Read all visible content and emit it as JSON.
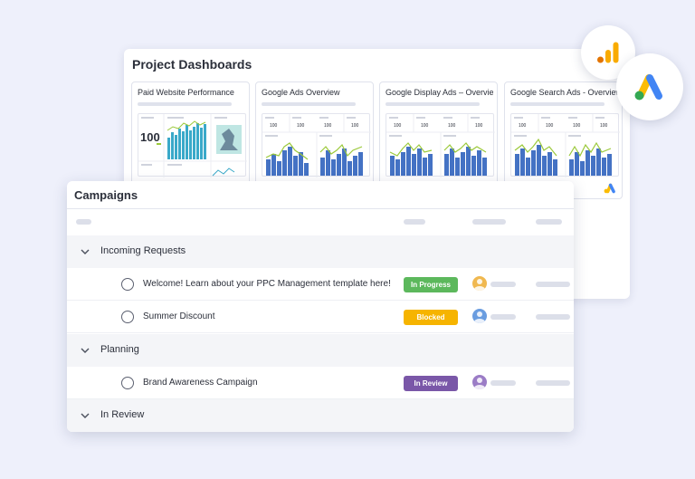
{
  "dashboards": {
    "title": "Project Dashboards",
    "cards": [
      {
        "title": "Paid Website Performance",
        "kpi": "100"
      },
      {
        "title": "Google Ads Overview",
        "kpi": "100"
      },
      {
        "title": "Google Display Ads – Overview",
        "kpi": "100"
      },
      {
        "title": "Google Search Ads - Overview",
        "kpi": "100"
      }
    ]
  },
  "logos": {
    "analytics_icon": "google-analytics-icon",
    "ads_icon": "google-ads-icon"
  },
  "campaigns": {
    "title": "Campaigns",
    "groups": [
      {
        "label": "Incoming Requests",
        "tasks": [
          {
            "name": "Welcome! Learn about your PPC Management template here!",
            "status": "In Progress",
            "status_color": "#5cb85c",
            "avatar_color": "#f0b84f"
          },
          {
            "name": "Summer Discount",
            "status": "Blocked",
            "status_color": "#f6b400",
            "avatar_color": "#6a9de0"
          }
        ]
      },
      {
        "label": "Planning",
        "tasks": [
          {
            "name": "Brand Awareness Campaign",
            "status": "In Review",
            "status_color": "#7a57a8",
            "avatar_color": "#9b7cc6"
          }
        ]
      },
      {
        "label": "In Review",
        "tasks": []
      }
    ]
  },
  "colors": {
    "background": "#eef0fb",
    "bar_blue": "#4472c4",
    "line_green": "#9bc93a",
    "ads_blue": "#4285f4",
    "ads_yellow": "#fbbc04",
    "ads_green": "#34a853"
  }
}
